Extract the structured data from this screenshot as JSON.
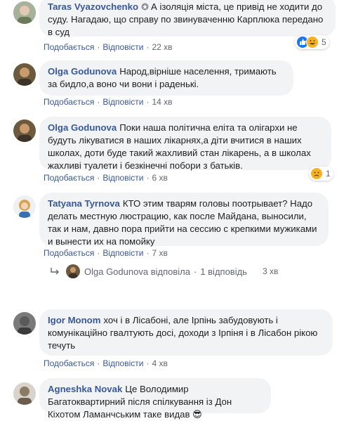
{
  "comments": [
    {
      "author": "Taras Vyazovchenko",
      "text": "А ізоляція міста, це привід не ходити до суду. Нагадаю, що справу по звинуваченню Карплюка передано в суд",
      "like": "Подобається",
      "reply": "Відповісти",
      "time": "22 хв",
      "reactions_count": "5"
    },
    {
      "author": "Olga Godunova",
      "text": "Народ,вірніше населення, тримають за бидло,а воно чи вони і раденькі.",
      "like": "Подобається",
      "reply": "Відповісти",
      "time": "14 хв"
    },
    {
      "author": "Olga Godunova",
      "text": "Поки наша політична еліта та олігархи не будуть лікуватися в наших лікарнях,а діти вчитися в наших школах, доти буде такий жахливий стан лікарень, а в школах жахливі туалети і безкінечні побори з батьків.",
      "like": "Подобається",
      "reply": "Відповісти",
      "time": "6 хв",
      "reactions_count": "1"
    },
    {
      "author": "Tatyana Tyrnova",
      "text": "КТО этим тварям головы поотрывает? Надо делать местную люстрацию, как после Майдана, выносили, так и нам, давно пора прийти на сессию с крепкими мужиками и вынести их на помойку",
      "like": "Подобається",
      "reply": "Відповісти",
      "time": "7 хв"
    },
    {
      "author": "Igor Monom",
      "text": "хоч і в Лісабоні, але Ірпінь забудовують і комунікаційно гвалтують досі, доходи з Ірпіня і в Лісабон рікою течуть",
      "like": "Подобається",
      "reply": "Відповісти",
      "time": "4 хв"
    },
    {
      "author": "Agneshka Novak",
      "text": "Це Володимир Багатоквартирний після спілкування із Дон Кіхотом Ламанчським таке видав",
      "emoji": "😎"
    }
  ],
  "reply_summary": {
    "author": "Olga Godunova",
    "verb": "відповіла",
    "count_text": "1 відповідь",
    "time": "3 хв"
  }
}
